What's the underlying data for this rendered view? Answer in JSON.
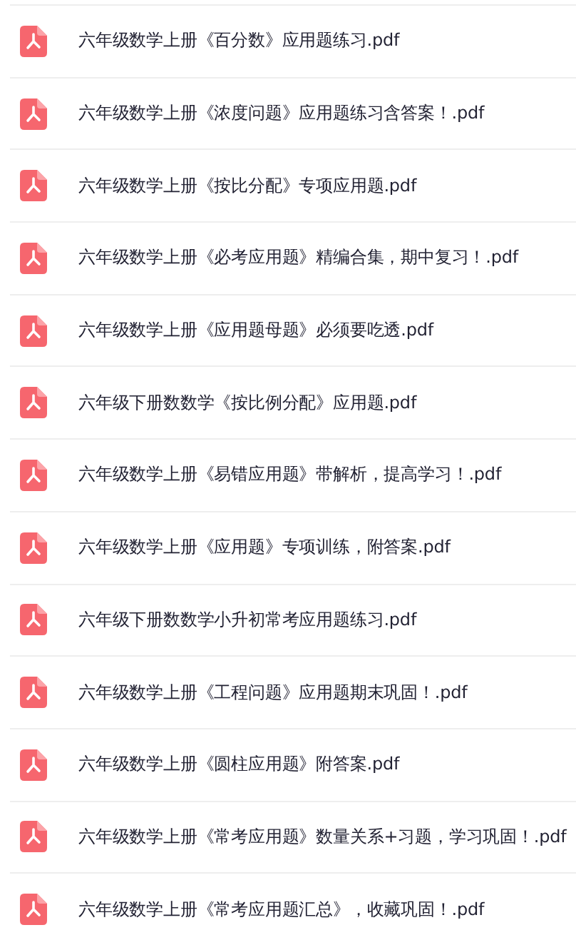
{
  "files": [
    {
      "name": "六年级数学上册《百分数》应用题练习.pdf"
    },
    {
      "name": "六年级数学上册《浓度问题》应用题练习含答案！.pdf"
    },
    {
      "name": "六年级数学上册《按比分配》专项应用题.pdf"
    },
    {
      "name": "六年级数学上册《必考应用题》精编合集，期中复习！.pdf"
    },
    {
      "name": "六年级数学上册《应用题母题》必须要吃透.pdf"
    },
    {
      "name": "六年级下册数数学《按比例分配》应用题.pdf"
    },
    {
      "name": "六年级数学上册《易错应用题》带解析，提高学习！.pdf"
    },
    {
      "name": "六年级数学上册《应用题》专项训练，附答案.pdf"
    },
    {
      "name": "六年级下册数数学小升初常考应用题练习.pdf"
    },
    {
      "name": "六年级数学上册《工程问题》应用题期末巩固！.pdf"
    },
    {
      "name": "六年级数学上册《圆柱应用题》附答案.pdf"
    },
    {
      "name": "六年级数学上册《常考应用题》数量关系+习题，学习巩固！.pdf"
    },
    {
      "name": "六年级数学上册《常考应用题汇总》，收藏巩固！.pdf"
    }
  ]
}
